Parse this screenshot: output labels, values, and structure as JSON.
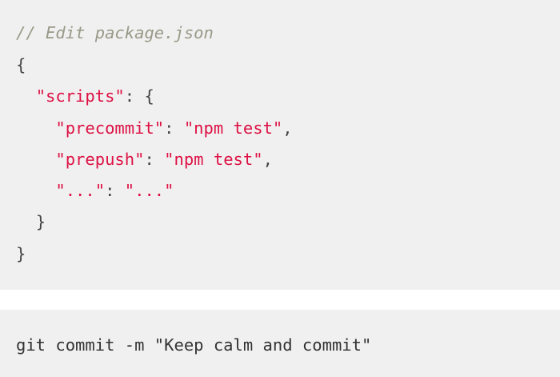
{
  "json_block": {
    "comment": "// Edit package.json",
    "open_brace": "{",
    "scripts_key": "\"scripts\"",
    "scripts_sep": ": {",
    "precommit_key": "\"precommit\"",
    "precommit_sep": ": ",
    "precommit_value": "\"npm test\"",
    "precommit_comma": ",",
    "prepush_key": "\"prepush\"",
    "prepush_sep": ": ",
    "prepush_value": "\"npm test\"",
    "prepush_comma": ",",
    "ellipsis_key": "\"...\"",
    "ellipsis_sep": ": ",
    "ellipsis_value": "\"...\"",
    "inner_close_brace": "}",
    "close_brace": "}"
  },
  "shell_block": {
    "command": "git commit -m \"Keep calm and commit\""
  },
  "colors": {
    "code_background": "#f0f0f0",
    "comment": "#999988",
    "string": "#dd1144",
    "punctuation": "#444444"
  }
}
